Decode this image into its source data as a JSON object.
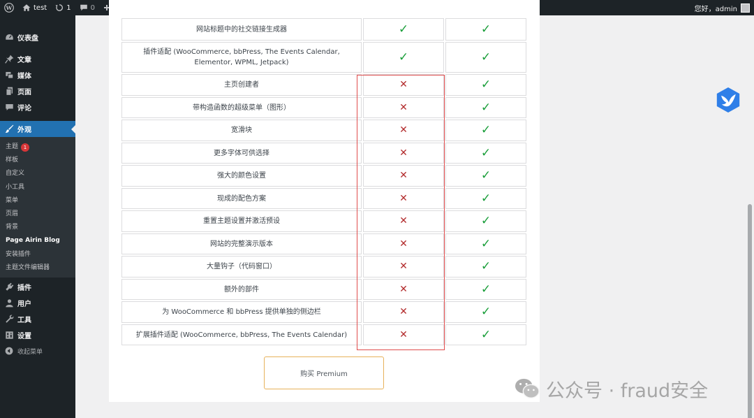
{
  "adminbar": {
    "site_name": "test",
    "updates_count": "1",
    "comments_count": "0",
    "new_label": "新建",
    "greeting": "您好，admin"
  },
  "sidebar": {
    "dashboard": "仪表盘",
    "posts": "文章",
    "media": "媒体",
    "pages": "页面",
    "comments": "评论",
    "appearance": "外观",
    "appearance_submenu": {
      "themes": "主题",
      "themes_badge": "1",
      "patterns": "样板",
      "customize": "自定义",
      "widgets": "小工具",
      "menus": "菜单",
      "header": "页眉",
      "background": "背景",
      "page_airin_blog": "Page Airin Blog",
      "install_plugins": "安装插件",
      "theme_file_editor": "主题文件编辑器"
    },
    "plugins": "插件",
    "users": "用户",
    "tools": "工具",
    "settings": "设置",
    "collapse": "收起菜单"
  },
  "table": {
    "rows": [
      {
        "feature": "网站标题中的社交链接生成器",
        "free": "✓",
        "premium": "✓"
      },
      {
        "feature": "插件适配 (WooCommerce, bbPress, The Events Calendar, Elementor, WPML, Jetpack)",
        "free": "✓",
        "premium": "✓"
      },
      {
        "feature": "主页创建者",
        "free": "✕",
        "premium": "✓"
      },
      {
        "feature": "带构造函数的超级菜单（图形）",
        "free": "✕",
        "premium": "✓"
      },
      {
        "feature": "宽滑块",
        "free": "✕",
        "premium": "✓"
      },
      {
        "feature": "更多字体可供选择",
        "free": "✕",
        "premium": "✓"
      },
      {
        "feature": "强大的颜色设置",
        "free": "✕",
        "premium": "✓"
      },
      {
        "feature": "现成的配色方案",
        "free": "✕",
        "premium": "✓"
      },
      {
        "feature": "重置主题设置并激活预设",
        "free": "✕",
        "premium": "✓"
      },
      {
        "feature": "网站的完整演示版本",
        "free": "✕",
        "premium": "✓"
      },
      {
        "feature": "大量钩子（代码窗口）",
        "free": "✕",
        "premium": "✓"
      },
      {
        "feature": "额外的部件",
        "free": "✕",
        "premium": "✓"
      },
      {
        "feature": "为 WooCommerce 和 bbPress 提供单独的侧边栏",
        "free": "✕",
        "premium": "✓"
      },
      {
        "feature": "扩展插件适配 (WooCommerce, bbPress, The Events Calendar)",
        "free": "✕",
        "premium": "✓"
      }
    ]
  },
  "buy_button": "购买 Premium",
  "watermark": {
    "text": "公众号 · fraud安全"
  },
  "colors": {
    "check": "#1a9e3a",
    "cross": "#b32d2e",
    "highlight": "#e04c4c",
    "admin_blue": "#2271b1"
  }
}
